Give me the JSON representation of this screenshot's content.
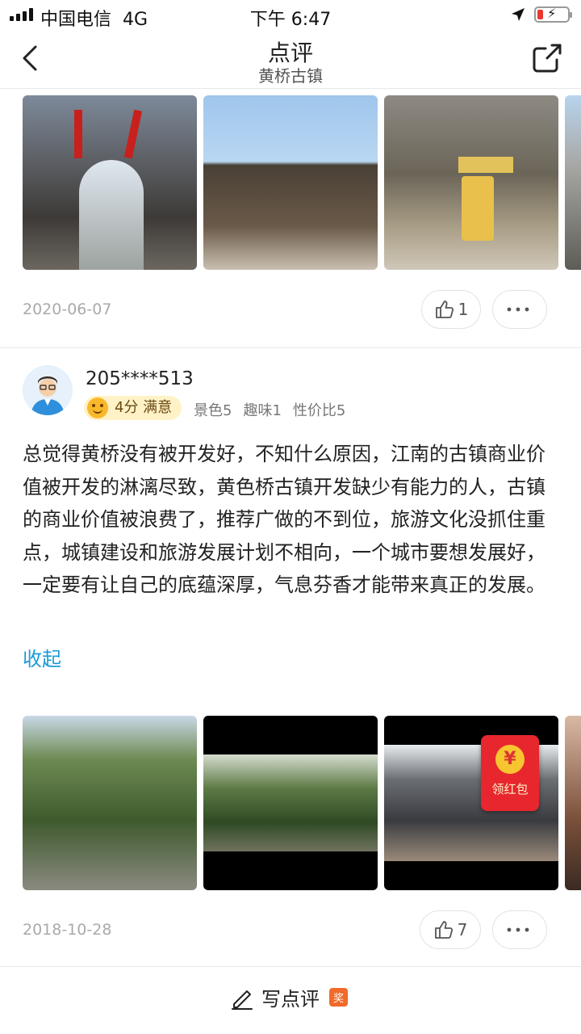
{
  "status_bar": {
    "carrier": "中国电信",
    "network": "4G",
    "time": "下午 6:47",
    "battery_level": 0.2
  },
  "nav": {
    "title": "点评",
    "subtitle": "黄桥古镇",
    "back_icon": "chevron-left-icon",
    "share_icon": "share-icon"
  },
  "review1": {
    "date": "2020-06-07",
    "likes": "1"
  },
  "review2": {
    "username": "205****513",
    "rating": "4分 满意",
    "sub_scores": [
      "景色5",
      "趣味1",
      "性价比5"
    ],
    "text": "总觉得黄桥没有被开发好，不知什么原因，江南的古镇商业价值被开发的淋漓尽致，黄色桥古镇开发缺少有能力的人，古镇的商业价值被浪费了，推荐广做的不到位，旅游文化没抓住重点，城镇建设和旅游发展计划不相向，一个城市要想发展好，一定要有让自己的底蕴深厚，气息芬香才能带来真正的发展。",
    "collapse_label": "收起",
    "date": "2018-10-28",
    "likes": "7",
    "red_packet_label": "领红包",
    "red_packet_symbol": "¥"
  },
  "bottom": {
    "write_label": "写点评",
    "award_badge": "奖"
  },
  "colors": {
    "link": "#1b9bd8",
    "badge_bg": "#fff2c6",
    "award": "#f06a2a",
    "red_packet": "#e8262e"
  }
}
